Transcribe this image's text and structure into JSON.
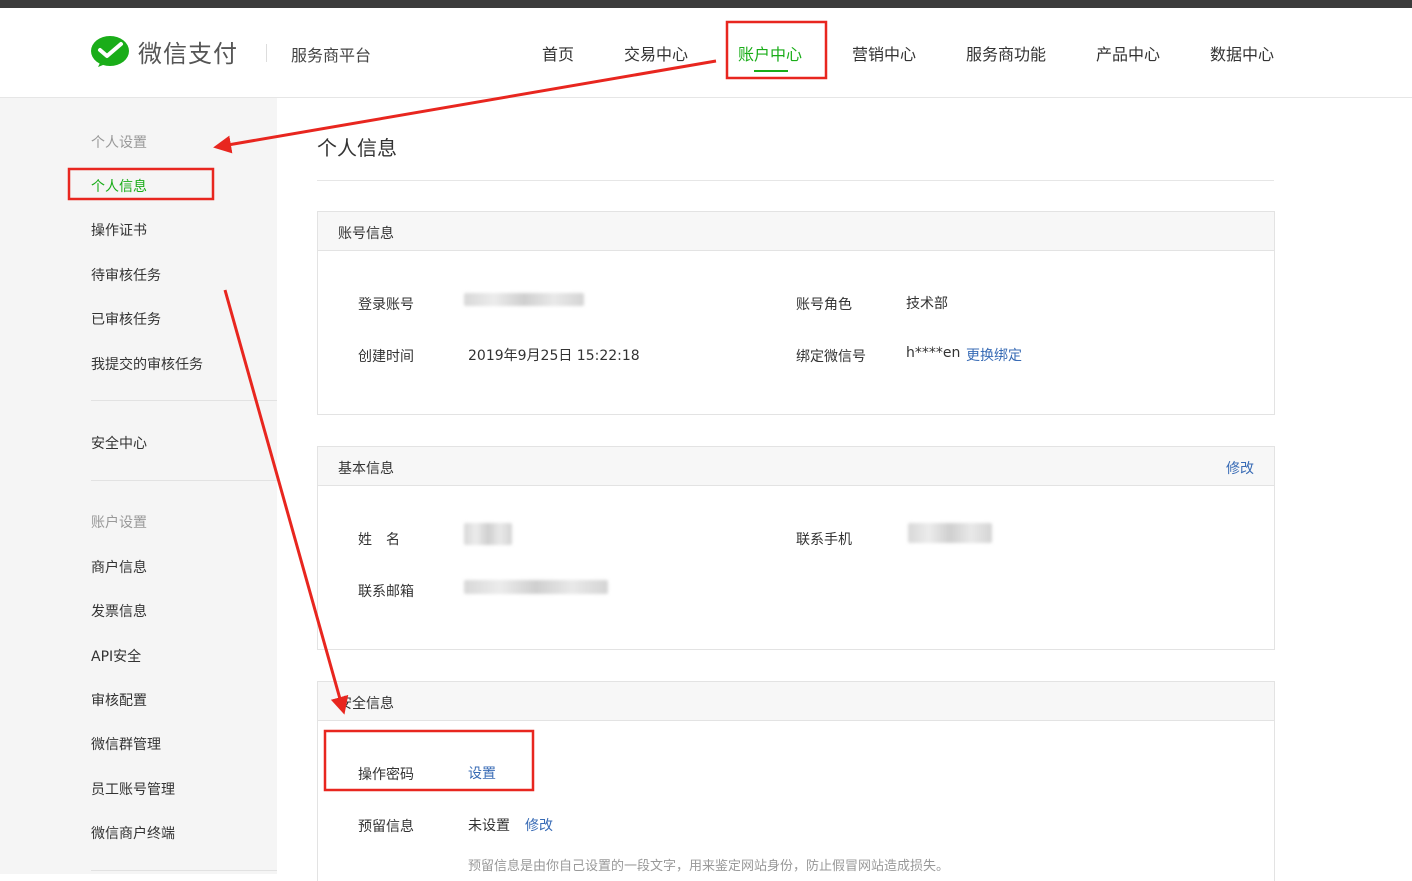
{
  "header": {
    "logo_text": "微信支付",
    "platform_label": "服务商平台",
    "nav": [
      "首页",
      "交易中心",
      "账户中心",
      "营销中心",
      "服务商功能",
      "产品中心",
      "数据中心"
    ],
    "active_nav": "账户中心"
  },
  "sidebar": {
    "group1": "个人设置",
    "items1": [
      "个人信息",
      "操作证书",
      "待审核任务",
      "已审核任务",
      "我提交的审核任务"
    ],
    "security": "安全中心",
    "group2": "账户设置",
    "items2": [
      "商户信息",
      "发票信息",
      "API安全",
      "审核配置",
      "微信群管理",
      "员工账号管理",
      "微信商户终端"
    ]
  },
  "main": {
    "page_title": "个人信息",
    "account_panel": {
      "title": "账号信息",
      "login_label": "登录账号",
      "role_label": "账号角色",
      "role_value": "技术部",
      "created_label": "创建时间",
      "created_value": "2019年9月25日 15:22:18",
      "wechat_label": "绑定微信号",
      "wechat_value": "h****en",
      "wechat_link": "更换绑定"
    },
    "basic_panel": {
      "title": "基本信息",
      "edit_link": "修改",
      "name_label": "姓　名",
      "phone_label": "联系手机",
      "email_label": "联系邮箱"
    },
    "security_panel": {
      "title": "安全信息",
      "password_label": "操作密码",
      "password_link": "设置",
      "reserved_label": "预留信息",
      "reserved_value": "未设置",
      "reserved_link": "修改",
      "reserved_hint": "预留信息是由你自己设置的一段文字，用来鉴定网站身份，防止假冒网站造成损失。"
    }
  },
  "colors": {
    "brand_green": "#1aad19",
    "link_blue": "#386bb5",
    "annotation_red": "#e8261f"
  }
}
